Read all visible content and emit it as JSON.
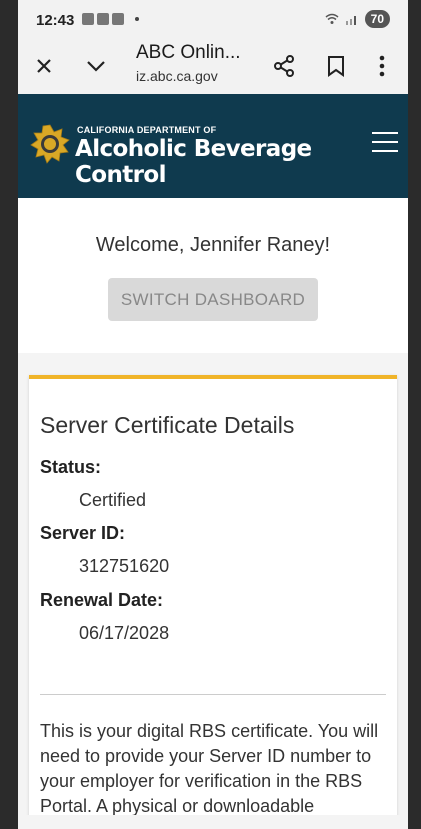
{
  "status_bar": {
    "time": "12:43",
    "battery": "70"
  },
  "browser": {
    "title": "ABC Onlin...",
    "url": "iz.abc.ca.gov"
  },
  "header": {
    "dept_small": "CALIFORNIA DEPARTMENT OF",
    "dept_big": "Alcoholic Beverage Control"
  },
  "welcome": {
    "text": "Welcome, Jennifer Raney!",
    "switch_button": "SWITCH DASHBOARD"
  },
  "card": {
    "title": "Server Certificate Details",
    "fields": [
      {
        "label": "Status:",
        "value": "Certified"
      },
      {
        "label": "Server ID:",
        "value": "312751620"
      },
      {
        "label": "Renewal Date:",
        "value": "06/17/2028"
      }
    ],
    "body": "This is your digital RBS certificate. You will need to provide your Server ID number to your employer for verification in the RBS Portal. A physical or downloadable"
  },
  "colors": {
    "header_bg": "#0f3a4e",
    "accent": "#f0b429"
  }
}
